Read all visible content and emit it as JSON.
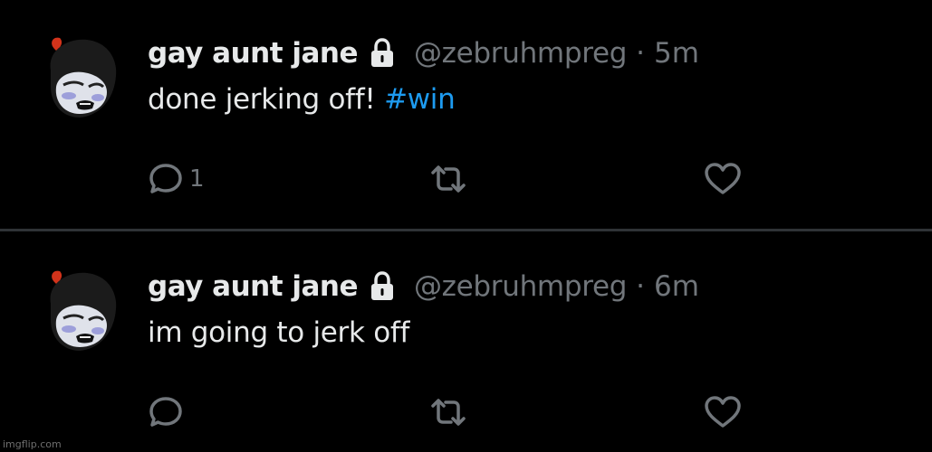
{
  "tweets": [
    {
      "display_name": "gay aunt jane",
      "handle": "@zebruhmpreg",
      "separator": "·",
      "time": "5m",
      "text": "done jerking off! ",
      "hashtag": "#win",
      "reply_count": "1",
      "icons": [
        "reply-icon",
        "retweet-icon",
        "like-icon",
        "lock-icon"
      ]
    },
    {
      "display_name": "gay aunt jane",
      "handle": "@zebruhmpreg",
      "separator": "·",
      "time": "6m",
      "text": "im going to jerk off",
      "hashtag": "",
      "reply_count": "",
      "icons": [
        "reply-icon",
        "retweet-icon",
        "like-icon",
        "lock-icon"
      ]
    }
  ],
  "watermark": "imgflip.com",
  "colors": {
    "background": "#000000",
    "primary_text": "#e7e9ea",
    "secondary_text": "#71767b",
    "hashtag": "#1d9bf0",
    "divider": "#2f3336"
  }
}
